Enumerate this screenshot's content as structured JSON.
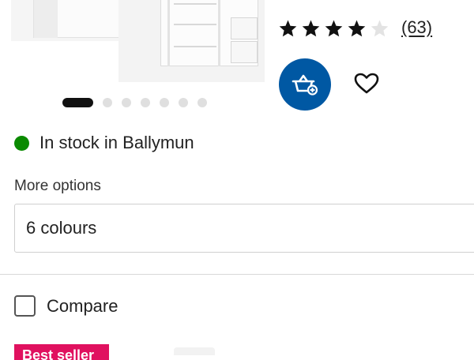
{
  "product": {
    "rating": {
      "value": 4,
      "max": 5,
      "review_count": "(63)"
    },
    "images": {
      "count": 7,
      "active_index": 0
    }
  },
  "actions": {
    "add_to_cart_icon": "shopping-basket-plus-icon",
    "favourite_icon": "heart-outline-icon"
  },
  "stock": {
    "text": "In stock in Ballymun",
    "status_color": "#0a8a00"
  },
  "options": {
    "label": "More options",
    "value": "6 colours"
  },
  "compare": {
    "label": "Compare",
    "checked": false
  },
  "badge": {
    "text": "Best seller"
  },
  "colors": {
    "primary_blue": "#0058a3",
    "badge_pink": "#e0115f"
  }
}
